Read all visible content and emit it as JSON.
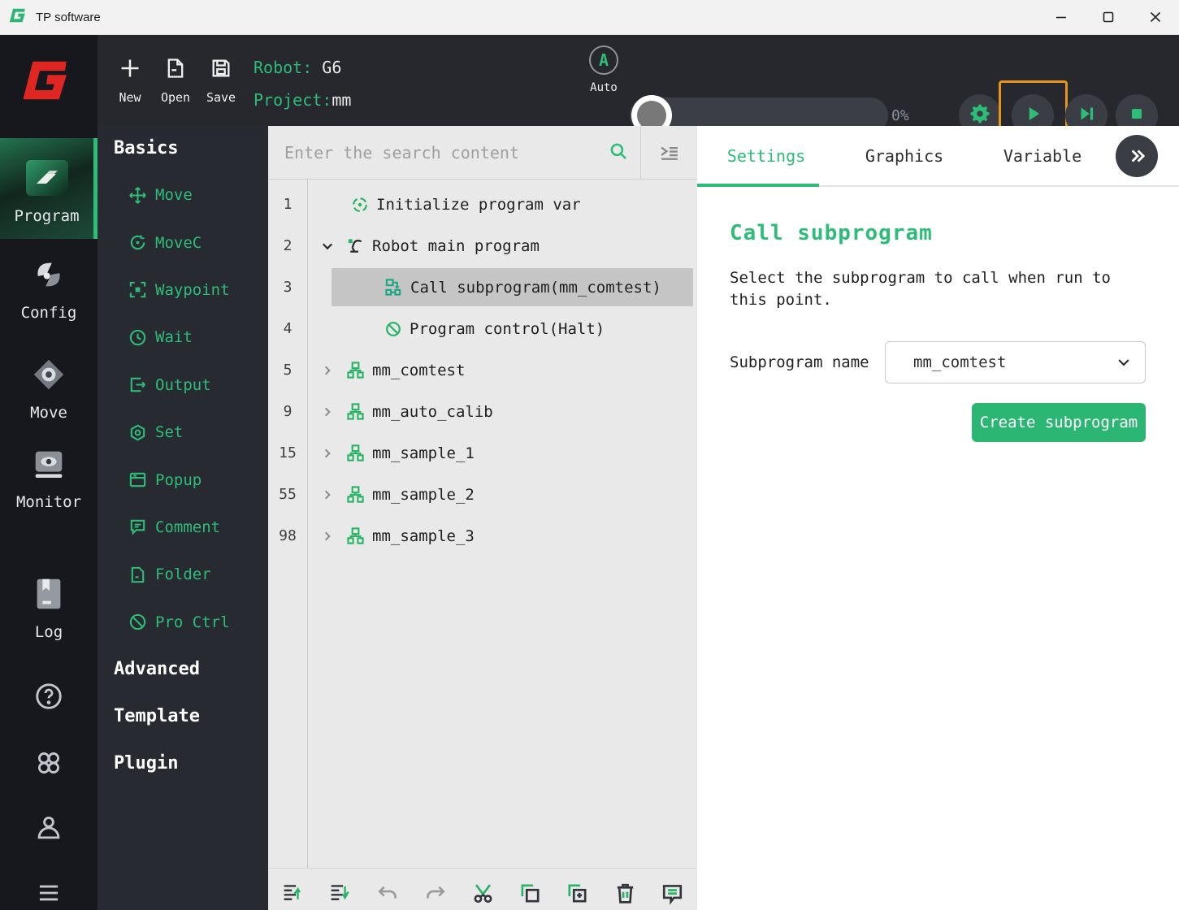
{
  "colors": {
    "accent": "#2dbd78",
    "teal": "#1ba784",
    "button_green": "#2bb673",
    "highlight_orange": "#e8941a",
    "logo_red": "#e02622"
  },
  "titlebar": {
    "app_title": "TP software"
  },
  "toolbar": {
    "new_label": "New",
    "open_label": "Open",
    "save_label": "Save",
    "robot_label": "Robot:",
    "robot_value": "G6",
    "project_label": "Project:",
    "project_value": "mm",
    "auto_badge": "A",
    "auto_label": "Auto",
    "progress_percent": "0%"
  },
  "sidebar": {
    "items": [
      {
        "label": "Program",
        "active": true
      },
      {
        "label": "Config"
      },
      {
        "label": "Move"
      },
      {
        "label": "Monitor"
      },
      {
        "label": "Log"
      }
    ]
  },
  "palette": {
    "basics_title": "Basics",
    "items": [
      {
        "label": "Move"
      },
      {
        "label": "MoveC"
      },
      {
        "label": "Waypoint"
      },
      {
        "label": "Wait"
      },
      {
        "label": "Output"
      },
      {
        "label": "Set"
      },
      {
        "label": "Popup"
      },
      {
        "label": "Comment"
      },
      {
        "label": "Folder"
      },
      {
        "label": "Pro Ctrl"
      }
    ],
    "advanced_title": "Advanced",
    "template_title": "Template",
    "plugin_title": "Plugin"
  },
  "tree": {
    "search_placeholder": "Enter the search content",
    "rows": [
      {
        "num": "1",
        "label": "Initialize program var"
      },
      {
        "num": "2",
        "label": "Robot main program"
      },
      {
        "num": "3",
        "label": "Call subprogram(mm_comtest)",
        "selected": true
      },
      {
        "num": "4",
        "label": "Program control(Halt)"
      },
      {
        "num": "5",
        "label": "mm_comtest"
      },
      {
        "num": "9",
        "label": "mm_auto_calib"
      },
      {
        "num": "15",
        "label": "mm_sample_1"
      },
      {
        "num": "55",
        "label": "mm_sample_2"
      },
      {
        "num": "98",
        "label": "mm_sample_3"
      }
    ]
  },
  "inspector": {
    "tabs": [
      {
        "label": "Settings",
        "active": true
      },
      {
        "label": "Graphics"
      },
      {
        "label": "Variable"
      }
    ],
    "heading": "Call subprogram",
    "description": "Select the subprogram to call when run to this point.",
    "field_label": "Subprogram name",
    "field_value": "mm_comtest",
    "create_button_label": "Create subprogram"
  }
}
